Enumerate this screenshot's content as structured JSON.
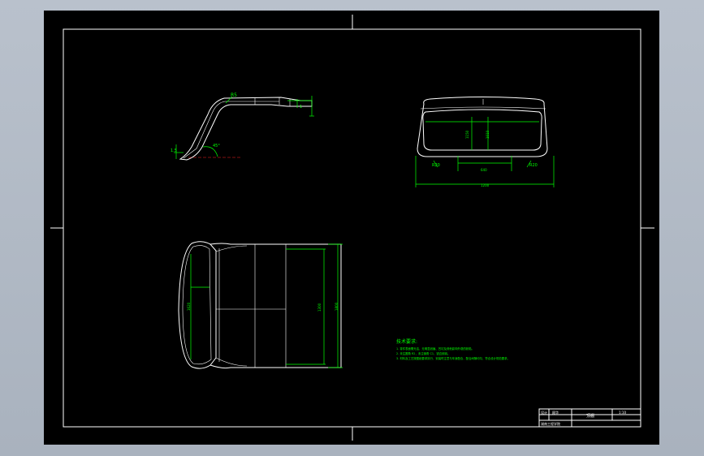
{
  "notes": {
    "title": "技术要求:",
    "lines": [
      "1. 零件表面需光洁，无明显划痕、凹坑及其他影响外观的缺陷。",
      "2. 未注圆角 R2，未注倒角 C1，锐边倒钝。",
      "3. 材料及工艺按图纸要求执行，安装时注意与车身配合，配合间隙均匀，符合设计规范要求。"
    ]
  },
  "title_block": {
    "design_label": "设计",
    "design_name": "顾华",
    "part_name": "顶棚",
    "scale": "1:10",
    "school": "湖南工程学院"
  },
  "dims": {
    "front_total": "1200",
    "front_inner": "640",
    "front_h1": "1150",
    "front_h2": "1010",
    "top_height": "1620",
    "top_inner": "1300",
    "top_right": "1800",
    "side_r": "R5",
    "side_angle": "45°",
    "side_left": "1.5",
    "side_t": "1",
    "front_r_left": "R20",
    "front_r_right": "R20"
  }
}
